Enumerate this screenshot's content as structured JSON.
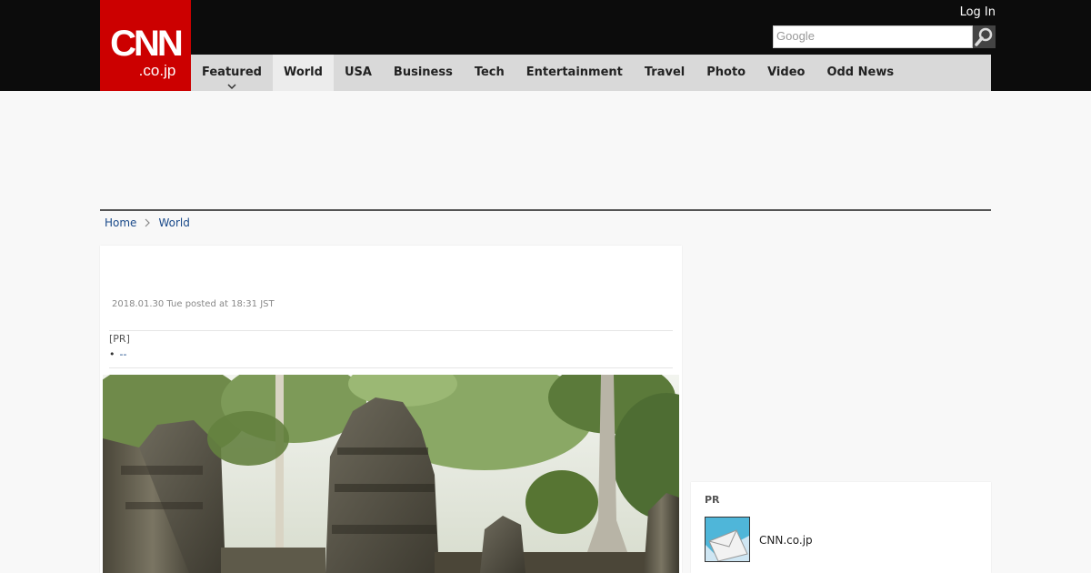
{
  "header": {
    "logo_main": "CNN",
    "logo_sub": ".co.jp",
    "login_label": "Log In",
    "search_placeholder": "Google",
    "search_icon": "magnifier-icon"
  },
  "nav": {
    "items": [
      {
        "label": "Featured",
        "has_dropdown": true
      },
      {
        "label": "World",
        "active": true
      },
      {
        "label": "USA"
      },
      {
        "label": "Business"
      },
      {
        "label": "Tech"
      },
      {
        "label": "Entertainment"
      },
      {
        "label": "Travel"
      },
      {
        "label": "Photo"
      },
      {
        "label": "Video"
      },
      {
        "label": "Odd News"
      }
    ]
  },
  "breadcrumb": {
    "home": "Home",
    "current": "World"
  },
  "article": {
    "posted": "2018.01.30 Tue posted at 18:31 JST",
    "pr_tag": "[PR]",
    "pr_bullet": "•",
    "pr_link": "--"
  },
  "sidebar": {
    "pr_title": "PR",
    "pr_item_label": "CNN.co.jp"
  },
  "colors": {
    "brand_red": "#cc0000",
    "topbar": "#0c0c0c",
    "nav_bg": "#d9d9d9",
    "link_blue": "#1a4a8a"
  }
}
